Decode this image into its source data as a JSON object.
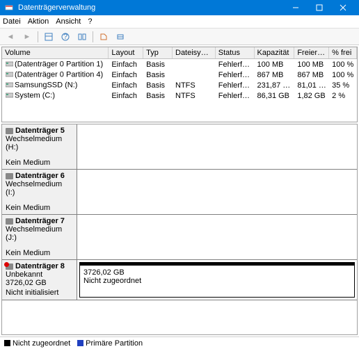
{
  "window": {
    "title": "Datenträgerverwaltung"
  },
  "menu": {
    "items": [
      "Datei",
      "Aktion",
      "Ansicht",
      "?"
    ]
  },
  "columns": [
    "Volume",
    "Layout",
    "Typ",
    "Dateisystem",
    "Status",
    "Kapazität",
    "Freier S...",
    "% frei"
  ],
  "volumes": [
    {
      "name": "(Datenträger 0 Partition 1)",
      "layout": "Einfach",
      "type": "Basis",
      "fs": "",
      "status": "Fehlerfrei ...",
      "cap": "100 MB",
      "free": "100 MB",
      "pct": "100 %"
    },
    {
      "name": "(Datenträger 0 Partition 4)",
      "layout": "Einfach",
      "type": "Basis",
      "fs": "",
      "status": "Fehlerfrei ...",
      "cap": "867 MB",
      "free": "867 MB",
      "pct": "100 %"
    },
    {
      "name": "SamsungSSD (N:)",
      "layout": "Einfach",
      "type": "Basis",
      "fs": "NTFS",
      "status": "Fehlerfrei ...",
      "cap": "231,87 GB",
      "free": "81,01 GB",
      "pct": "35 %"
    },
    {
      "name": "System (C:)",
      "layout": "Einfach",
      "type": "Basis",
      "fs": "NTFS",
      "status": "Fehlerfrei ...",
      "cap": "86,31 GB",
      "free": "1,82 GB",
      "pct": "2 %"
    }
  ],
  "disks": [
    {
      "title": "Datenträger 5",
      "line1": "Wechselmedium (H:)",
      "line2": "",
      "line3": "Kein Medium",
      "icon": "normal",
      "vol_line1": "",
      "vol_line2": "",
      "stripe": false
    },
    {
      "title": "Datenträger 6",
      "line1": "Wechselmedium (I:)",
      "line2": "",
      "line3": "Kein Medium",
      "icon": "normal",
      "vol_line1": "",
      "vol_line2": "",
      "stripe": false
    },
    {
      "title": "Datenträger 7",
      "line1": "Wechselmedium (J:)",
      "line2": "",
      "line3": "Kein Medium",
      "icon": "normal",
      "vol_line1": "",
      "vol_line2": "",
      "stripe": false
    },
    {
      "title": "Datenträger 8",
      "line1": "Unbekannt",
      "line2": "3726,02 GB",
      "line3": "Nicht initialisiert",
      "icon": "red",
      "vol_line1": "3726,02 GB",
      "vol_line2": "Nicht zugeordnet",
      "stripe": true
    }
  ],
  "legend": {
    "unalloc": "Nicht zugeordnet",
    "primary": "Primäre Partition",
    "colors": {
      "unalloc": "#000000",
      "primary": "#2040c0"
    }
  }
}
